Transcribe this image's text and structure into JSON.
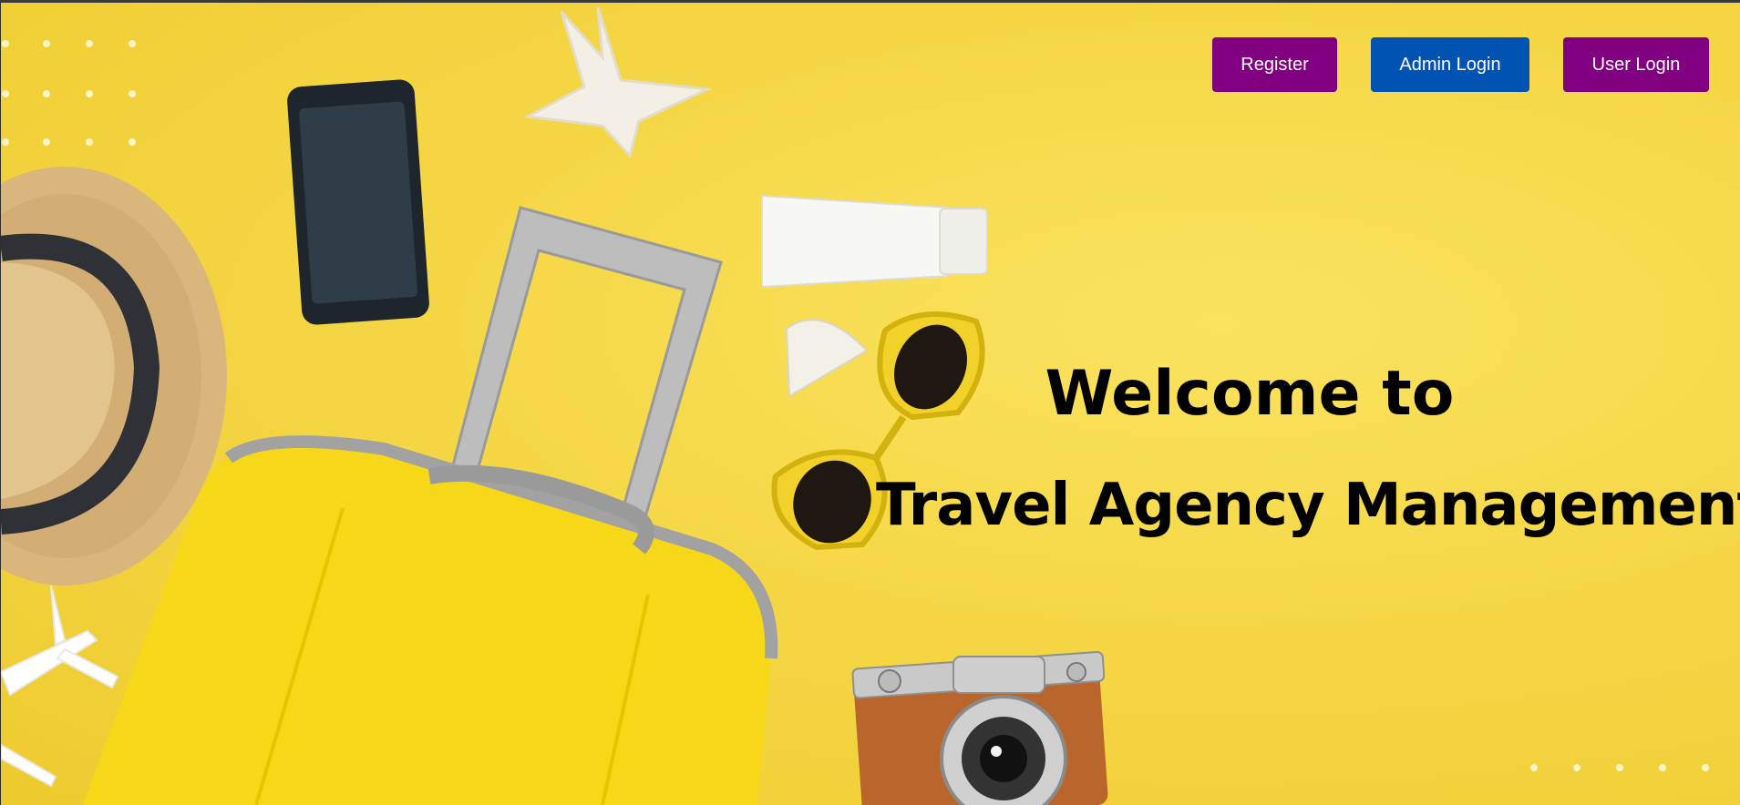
{
  "colors": {
    "background": "#f5d746",
    "register_button": "#800080",
    "admin_login_button": "#0053b3",
    "user_login_button": "#800080",
    "hero_text": "#000000"
  },
  "nav": {
    "register_label": "Register",
    "admin_login_label": "Admin Login",
    "user_login_label": "User Login"
  },
  "hero": {
    "line1": "Welcome to",
    "line2": "Travel Agency Management"
  },
  "background_icons": [
    "straw-hat-icon",
    "smartphone-icon",
    "starfish-icon",
    "sunscreen-tube-icon",
    "sponge-icon",
    "sunglasses-icon",
    "suitcase-icon",
    "toy-airplane-icon",
    "camera-icon"
  ]
}
